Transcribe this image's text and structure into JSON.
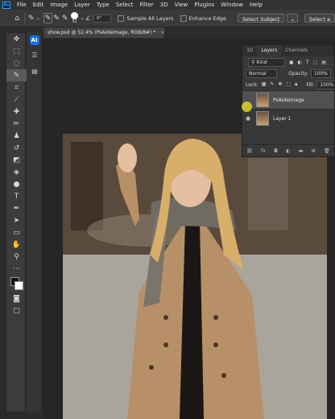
{
  "menubar": {
    "logo": "Ps",
    "items": [
      "File",
      "Edit",
      "Image",
      "Layer",
      "Type",
      "Select",
      "Filter",
      "3D",
      "View",
      "Plugins",
      "Window",
      "Help"
    ]
  },
  "options": {
    "brush_size": "42",
    "angle": "0°",
    "sample_all_layers": "Sample All Layers",
    "enhance_edge": "Enhance Edge",
    "select_subject": "Select Subject",
    "select_and_mask": "Select a"
  },
  "document": {
    "tab_title": "show.psd @ 52.4% (PsAideImage, RGB/8#) *",
    "close": "×"
  },
  "sidebar": {
    "ai_label": "AI"
  },
  "layers_panel": {
    "tabs": [
      "3D",
      "Layers",
      "Channels"
    ],
    "kind": "Kind",
    "blend_mode": "Normal",
    "opacity_label": "Opacity:",
    "opacity_value": "100%",
    "lock_label": "Lock:",
    "fill_label": "Fill:",
    "fill_value": "100%",
    "layers": [
      {
        "name": "PsAideImage",
        "selected": true
      },
      {
        "name": "Layer 1",
        "selected": false
      }
    ]
  },
  "colors": {
    "accent": "#31a8ff",
    "ai_button": "#1473e6",
    "cursor": "#e6dc28"
  }
}
